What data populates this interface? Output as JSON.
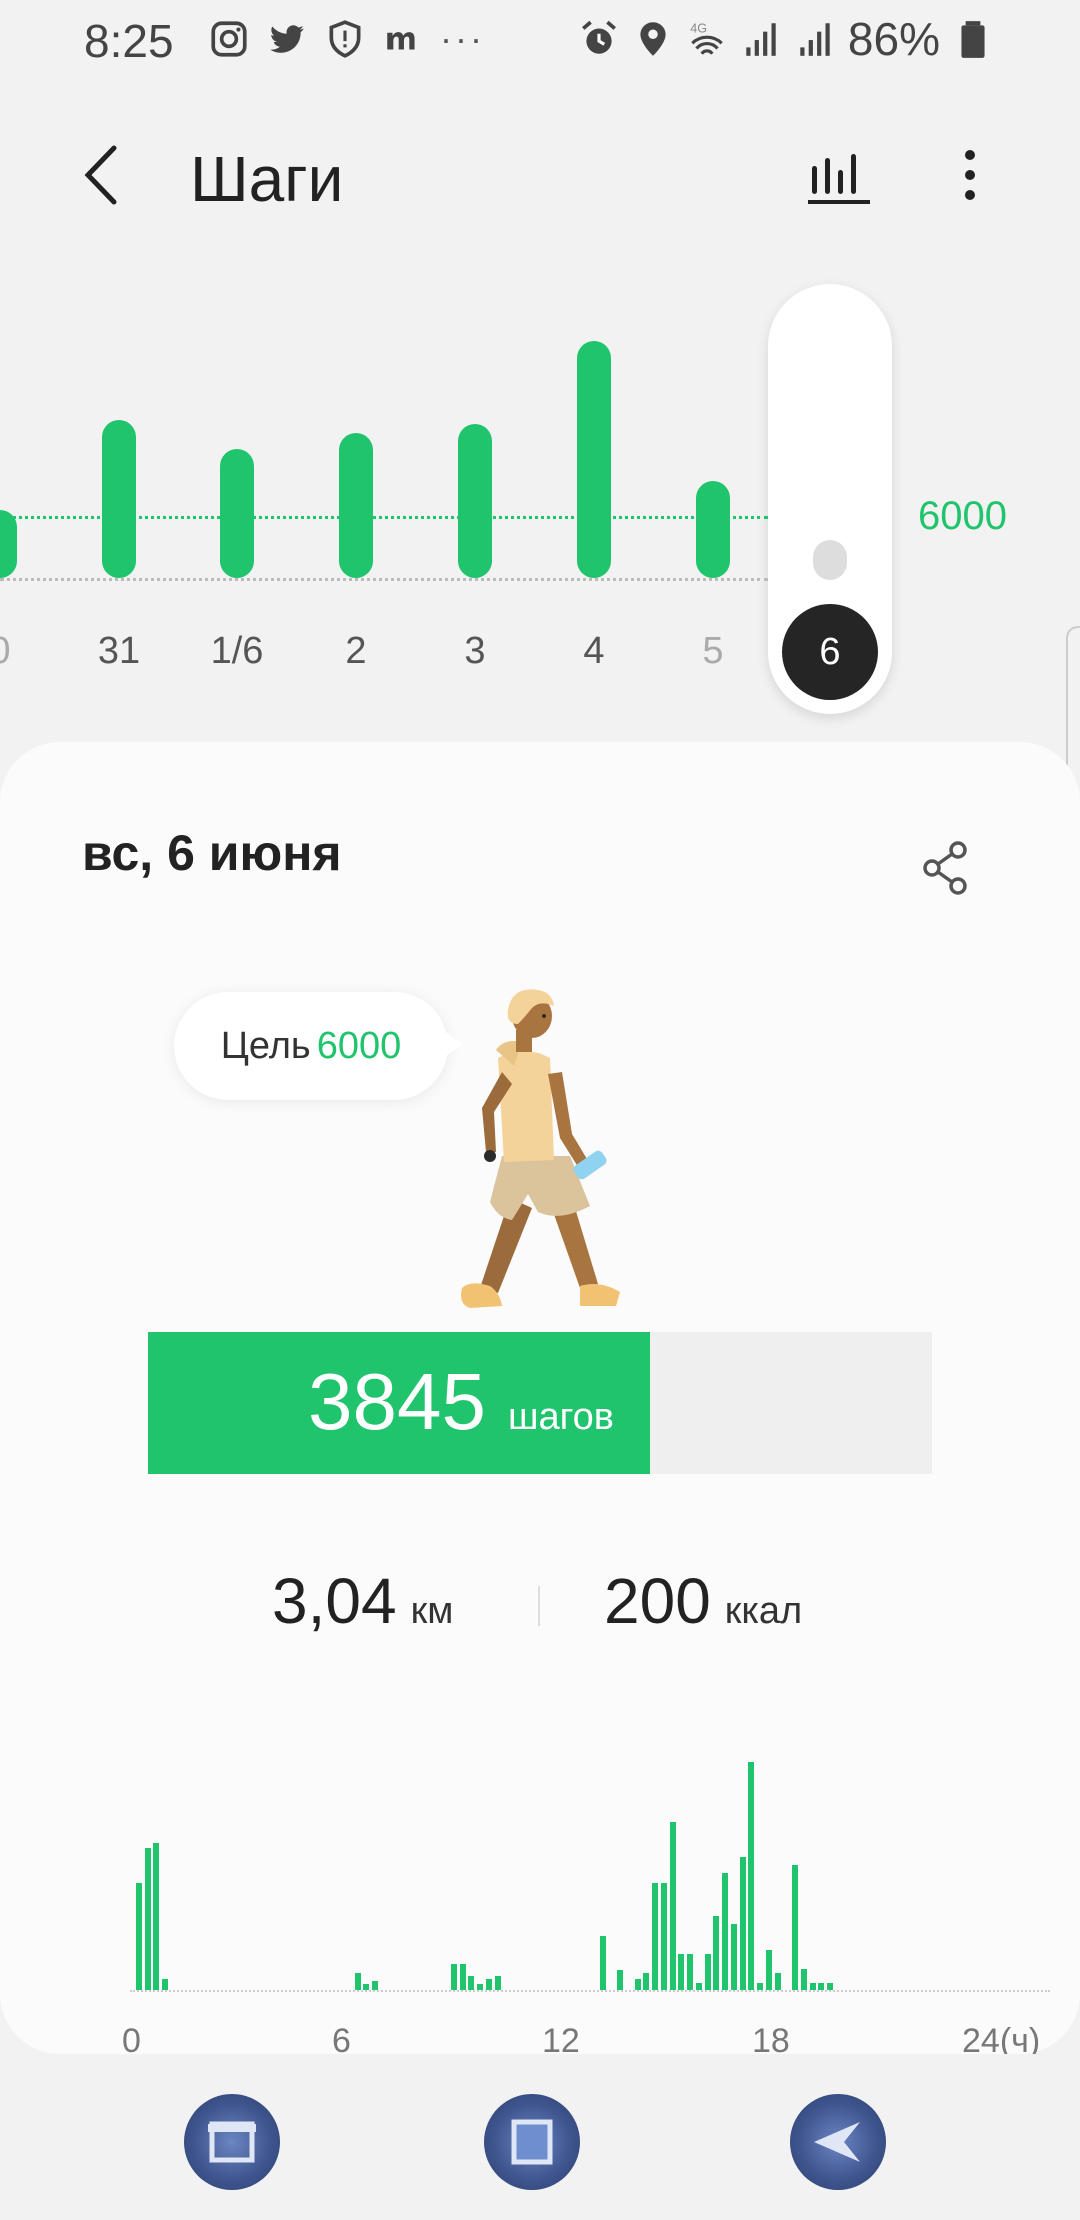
{
  "status_bar": {
    "time": "8:25",
    "battery": "86%",
    "icons_left": [
      "instagram-icon",
      "twitter-icon",
      "shield-icon",
      "m-icon"
    ],
    "overflow": "···",
    "icons_right": [
      "alarm-icon",
      "location-icon",
      "wifi-4g-icon",
      "signal-icon",
      "signal-icon",
      "battery-icon"
    ]
  },
  "header": {
    "title": "Шаги"
  },
  "week_chart": {
    "goal_label": "6000",
    "days": [
      {
        "label": "0",
        "steps": 3000
      },
      {
        "label": "31",
        "steps": 7000
      },
      {
        "label": "1/6",
        "steps": 5700
      },
      {
        "label": "2",
        "steps": 6400
      },
      {
        "label": "3",
        "steps": 6800
      },
      {
        "label": "4",
        "steps": 10500
      },
      {
        "label": "5",
        "steps": 4300
      },
      {
        "label": "6",
        "steps": 3845
      }
    ],
    "selected": "6"
  },
  "card": {
    "date": "вс, 6 июня",
    "goal_label": "Цель",
    "goal_value": "6000",
    "steps_value": "3845",
    "steps_unit": "шагов",
    "steps_progress": 0.64,
    "distance_value": "3,04",
    "distance_unit": "км",
    "calories_value": "200",
    "calories_unit": "ккал"
  },
  "chart_data": {
    "type": "bar",
    "title": "",
    "xlabel": "",
    "ylabel": "",
    "x_ticks": [
      "0",
      "6",
      "12",
      "18",
      "24(ч)"
    ],
    "xlim": [
      0,
      24
    ],
    "series": [
      {
        "x": [
          0.25,
          0.5,
          0.75,
          1.0,
          6.5,
          6.75,
          7.0,
          9.25,
          9.5,
          9.75,
          10.0,
          10.25,
          10.5,
          13.5,
          14.0,
          14.5,
          14.75,
          15.0,
          15.25,
          15.5,
          15.75,
          16.0,
          16.25,
          16.5,
          16.75,
          17.0,
          17.25,
          17.5,
          17.75,
          18.0,
          18.25,
          18.5,
          19.0,
          19.25,
          19.5,
          19.75,
          20.0
        ],
        "values": [
          75,
          100,
          103,
          8,
          12,
          4,
          6,
          18,
          18,
          10,
          4,
          8,
          10,
          38,
          14,
          8,
          12,
          75,
          75,
          118,
          25,
          25,
          5,
          25,
          52,
          82,
          46,
          93,
          160,
          5,
          28,
          12,
          88,
          15,
          5,
          5,
          5
        ]
      }
    ]
  },
  "nav_bar": {
    "buttons": [
      "recent-apps-icon",
      "home-icon",
      "back-icon"
    ]
  }
}
